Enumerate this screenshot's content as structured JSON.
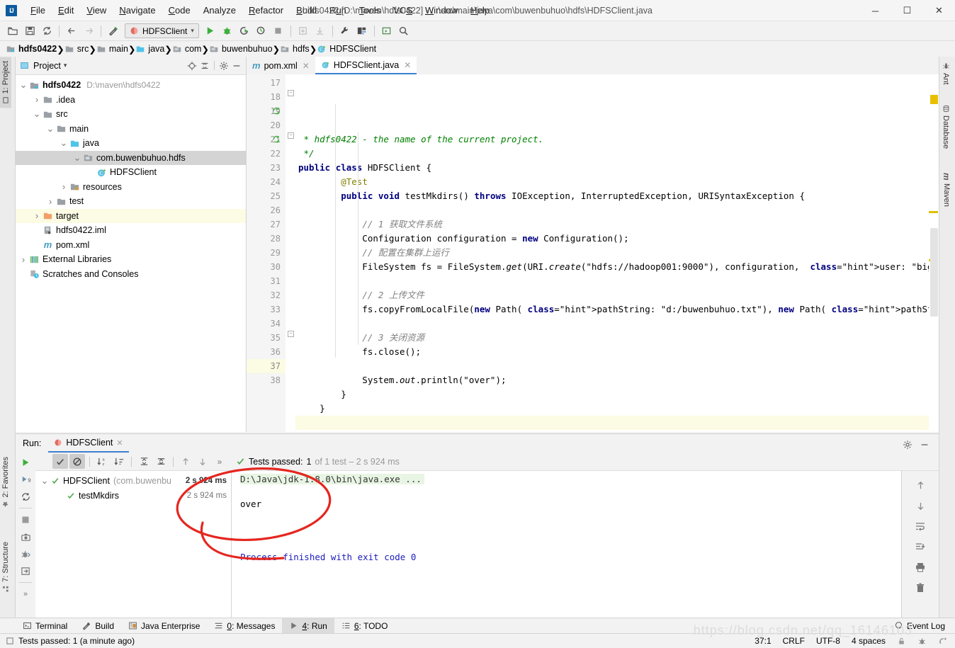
{
  "window": {
    "title": "hdfs0422 [D:\\maven\\hdfs0422] - ...\\src\\main\\java\\com\\buwenbuhuo\\hdfs\\HDFSClient.java",
    "minimize": "─",
    "maximize": "☐",
    "close": "✕"
  },
  "menu": [
    {
      "label": "File"
    },
    {
      "label": "Edit"
    },
    {
      "label": "View"
    },
    {
      "label": "Navigate"
    },
    {
      "label": "Code"
    },
    {
      "label": "Analyze"
    },
    {
      "label": "Refactor"
    },
    {
      "label": "Build"
    },
    {
      "label": "Run"
    },
    {
      "label": "Tools"
    },
    {
      "label": "VCS"
    },
    {
      "label": "Window"
    },
    {
      "label": "Help"
    }
  ],
  "toolbar": {
    "run_config": "HDFSClient",
    "icons": [
      "open-folder-icon",
      "save-icon",
      "sync-icon",
      "back-arrow-icon",
      "forward-arrow-icon",
      "build-hammer-icon",
      "run-icon",
      "debug-icon",
      "run-coverage-icon",
      "profile-icon",
      "stop-icon",
      "update-app-icon",
      "pull-icon",
      "settings-wrench-icon",
      "project-structure-icon",
      "console-icon",
      "search-icon"
    ]
  },
  "breadcrumb": [
    {
      "label": "hdfs0422",
      "icon": "module-icon"
    },
    {
      "label": "src",
      "icon": "folder-icon"
    },
    {
      "label": "main",
      "icon": "folder-icon"
    },
    {
      "label": "java",
      "icon": "source-root-icon"
    },
    {
      "label": "com",
      "icon": "package-icon"
    },
    {
      "label": "buwenbuhuo",
      "icon": "package-icon"
    },
    {
      "label": "hdfs",
      "icon": "package-icon"
    },
    {
      "label": "HDFSClient",
      "icon": "class-icon"
    }
  ],
  "left_stripe": [
    {
      "label": "1: Project",
      "icon": "project-icon",
      "active": true
    },
    {
      "label": "2: Favorites",
      "icon": "star-icon",
      "active": false
    },
    {
      "label": "7: Structure",
      "icon": "structure-icon",
      "active": false
    }
  ],
  "right_stripe": [
    {
      "label": "Ant",
      "icon": "ant-icon"
    },
    {
      "label": "Database",
      "icon": "database-icon"
    },
    {
      "label": "Maven",
      "icon": "maven-icon"
    }
  ],
  "project_panel": {
    "title": "Project",
    "header_icons": [
      "locate-icon",
      "collapse-all-icon",
      "gear-icon",
      "hide-icon"
    ],
    "tree": [
      {
        "label": "hdfs0422",
        "path": "D:\\maven\\hdfs0422",
        "depth": 0,
        "twisty": "⌄",
        "icon": "module-icon",
        "bold": true,
        "state": "normal"
      },
      {
        "label": ".idea",
        "path": "",
        "depth": 1,
        "twisty": "›",
        "icon": "folder-icon",
        "bold": false,
        "state": "normal"
      },
      {
        "label": "src",
        "path": "",
        "depth": 1,
        "twisty": "⌄",
        "icon": "folder-icon",
        "bold": false,
        "state": "normal"
      },
      {
        "label": "main",
        "path": "",
        "depth": 2,
        "twisty": "⌄",
        "icon": "folder-icon",
        "bold": false,
        "state": "normal"
      },
      {
        "label": "java",
        "path": "",
        "depth": 3,
        "twisty": "⌄",
        "icon": "source-root-icon",
        "bold": false,
        "state": "normal"
      },
      {
        "label": "com.buwenbuhuo.hdfs",
        "path": "",
        "depth": 4,
        "twisty": "⌄",
        "icon": "package-icon",
        "bold": false,
        "state": "selected"
      },
      {
        "label": "HDFSClient",
        "path": "",
        "depth": 5,
        "twisty": "",
        "icon": "class-icon",
        "bold": false,
        "state": "normal"
      },
      {
        "label": "resources",
        "path": "",
        "depth": 3,
        "twisty": "›",
        "icon": "resource-root-icon",
        "bold": false,
        "state": "normal"
      },
      {
        "label": "test",
        "path": "",
        "depth": 2,
        "twisty": "›",
        "icon": "folder-icon",
        "bold": false,
        "state": "normal"
      },
      {
        "label": "target",
        "path": "",
        "depth": 1,
        "twisty": "›",
        "icon": "excluded-folder-icon",
        "bold": false,
        "state": "highlight"
      },
      {
        "label": "hdfs0422.iml",
        "path": "",
        "depth": 1,
        "twisty": "",
        "icon": "iml-file-icon",
        "bold": false,
        "state": "normal"
      },
      {
        "label": "pom.xml",
        "path": "",
        "depth": 1,
        "twisty": "",
        "icon": "maven-file-icon",
        "bold": false,
        "state": "normal"
      },
      {
        "label": "External Libraries",
        "path": "",
        "depth": 0,
        "twisty": "›",
        "icon": "libraries-icon",
        "bold": false,
        "state": "normal"
      },
      {
        "label": "Scratches and Consoles",
        "path": "",
        "depth": 0,
        "twisty": "",
        "icon": "scratches-icon",
        "bold": false,
        "state": "normal"
      }
    ]
  },
  "editor": {
    "tabs": [
      {
        "label": "pom.xml",
        "icon": "maven-file-icon",
        "active": false
      },
      {
        "label": "HDFSClient.java",
        "icon": "class-icon",
        "active": true
      }
    ],
    "first_line": 17,
    "caret_line": 37,
    "lines": [
      {
        "n": 17,
        "text": " * hdfs0422 - the name of the current project."
      },
      {
        "n": 18,
        "text": " */"
      },
      {
        "n": 19,
        "text": "public class HDFSClient {"
      },
      {
        "n": 20,
        "text": "        @Test"
      },
      {
        "n": 21,
        "text": "        public void testMkdirs() throws IOException, InterruptedException, URISyntaxException {"
      },
      {
        "n": 22,
        "text": ""
      },
      {
        "n": 23,
        "text": "            // 1 获取文件系统"
      },
      {
        "n": 24,
        "text": "            Configuration configuration = new Configuration();"
      },
      {
        "n": 25,
        "text": "            // 配置在集群上运行"
      },
      {
        "n": 26,
        "text": "            FileSystem fs = FileSystem.get(URI.create(\"hdfs://hadoop001:9000\"), configuration,  user: \"bigdata\");"
      },
      {
        "n": 27,
        "text": ""
      },
      {
        "n": 28,
        "text": "            // 2 上传文件"
      },
      {
        "n": 29,
        "text": "            fs.copyFromLocalFile(new Path( pathString: \"d:/buwenbuhuo.txt\"), new Path( pathString: \"/buwenbuhuo.txt\"));"
      },
      {
        "n": 30,
        "text": ""
      },
      {
        "n": 31,
        "text": "            // 3 关闭资源"
      },
      {
        "n": 32,
        "text": "            fs.close();"
      },
      {
        "n": 33,
        "text": ""
      },
      {
        "n": 34,
        "text": "            System.out.println(\"over\");"
      },
      {
        "n": 35,
        "text": "        }"
      },
      {
        "n": 36,
        "text": "    }"
      },
      {
        "n": 37,
        "text": ""
      },
      {
        "n": 38,
        "text": ""
      }
    ]
  },
  "run_window": {
    "label": "Run:",
    "tab": "HDFSClient",
    "toolbar_icons": [
      "rerun-icon",
      "show-passed-icon",
      "hide-ignored-icon",
      "sort-alpha-icon",
      "sort-duration-icon",
      "expand-all-icon",
      "collapse-all-icon",
      "prev-failed-icon",
      "next-failed-icon",
      "more-icon"
    ],
    "status_prefix": "Tests passed:",
    "status_count": "1",
    "status_suffix": "of 1 test – 2 s 924 ms",
    "left_toolbar_icons": [
      "rerun-green-icon",
      "rerun-failed-icon",
      "rerun-auto-icon",
      "stop-icon",
      "screenshot-icon",
      "dump-threads-icon",
      "export-icon",
      "more-icon"
    ],
    "tests": [
      {
        "name": "HDFSClient",
        "detail": "(com.buwenbu",
        "duration": "2 s 924 ms",
        "depth": 0,
        "twisty": "⌄",
        "bold": true
      },
      {
        "name": "testMkdirs",
        "detail": "",
        "duration": "2 s 924 ms",
        "depth": 1,
        "twisty": "",
        "bold": false
      }
    ],
    "console": {
      "command": "D:\\Java\\jdk-1.8.0\\bin\\java.exe ...",
      "output": "over",
      "finished": "Process finished with exit code 0"
    },
    "console_toolbar_icons": [
      "up-arrow-icon",
      "down-arrow-icon",
      "soft-wrap-icon",
      "scroll-to-end-icon",
      "print-icon",
      "trash-icon"
    ],
    "gear": "gear-icon",
    "minimize": "hide-icon"
  },
  "tool_windows": [
    {
      "label": "Terminal",
      "num": "",
      "icon": "terminal-icon",
      "active": false
    },
    {
      "label": "Build",
      "num": "",
      "icon": "build-hammer-icon",
      "active": false
    },
    {
      "label": "Java Enterprise",
      "num": "",
      "icon": "java-ee-icon",
      "active": false
    },
    {
      "label": "0: Messages",
      "num": "0",
      "icon": "messages-icon",
      "active": false
    },
    {
      "label": "4: Run",
      "num": "4",
      "icon": "run-icon",
      "active": true
    },
    {
      "label": "6: TODO",
      "num": "6",
      "icon": "todo-icon",
      "active": false
    }
  ],
  "event_log": {
    "label": "Event Log",
    "icon": "event-log-icon"
  },
  "statusbar": {
    "message": "Tests passed: 1 (a minute ago)",
    "message_icon": "status-box-icon",
    "caret_position": "37:1",
    "line_separator": "CRLF",
    "encoding": "UTF-8",
    "indent": "4 spaces",
    "icons": [
      "lock-icon",
      "inspection-icon",
      "git-branch-icon"
    ]
  },
  "watermark": "https://blog.csdn.net/qq_16146103",
  "colors": {
    "accent_blue": "#3d7fd1",
    "keyword": "#000080",
    "string": "#008000",
    "comment": "#808080",
    "annotation_red": "#e02020",
    "warning_yellow": "#e0c000",
    "success_green": "#49a349"
  }
}
